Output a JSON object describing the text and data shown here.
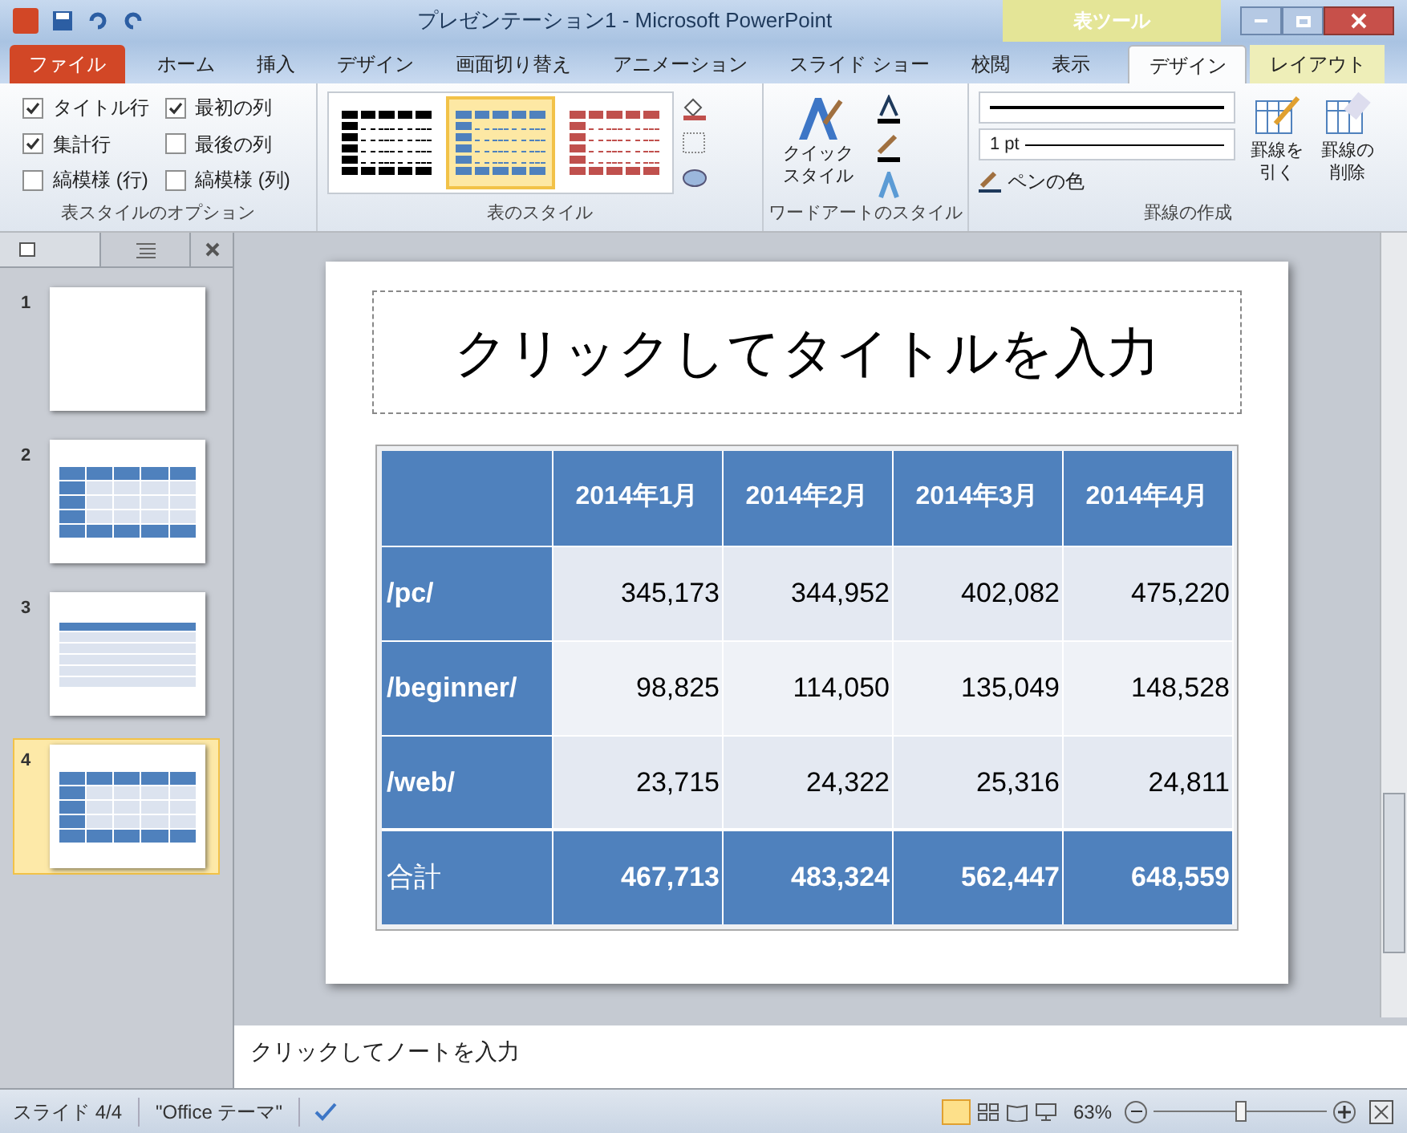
{
  "window": {
    "title": "プレゼンテーション1 - Microsoft PowerPoint",
    "context_group": "表ツール"
  },
  "ribbon_tabs": [
    {
      "label": "ファイル",
      "kind": "file",
      "selected": false
    },
    {
      "label": "ホーム",
      "kind": "tab",
      "selected": false
    },
    {
      "label": "挿入",
      "kind": "tab",
      "selected": false
    },
    {
      "label": "デザイン",
      "kind": "tab",
      "selected": false
    },
    {
      "label": "画面切り替え",
      "kind": "tab",
      "selected": false
    },
    {
      "label": "アニメーション",
      "kind": "tab",
      "selected": false
    },
    {
      "label": "スライド ショー",
      "kind": "tab",
      "selected": false
    },
    {
      "label": "校閲",
      "kind": "tab",
      "selected": false
    },
    {
      "label": "表示",
      "kind": "tab",
      "selected": false
    },
    {
      "label": "デザイン",
      "kind": "context",
      "selected": true
    },
    {
      "label": "レイアウト",
      "kind": "context",
      "selected": false
    }
  ],
  "style_options": {
    "label": "表スタイルのオプション",
    "items": [
      {
        "label": "タイトル行",
        "checked": true
      },
      {
        "label": "集計行",
        "checked": true
      },
      {
        "label": "縞模様 (行)",
        "checked": false
      },
      {
        "label": "最初の列",
        "checked": true
      },
      {
        "label": "最後の列",
        "checked": false
      },
      {
        "label": "縞模様 (列)",
        "checked": false
      }
    ]
  },
  "table_styles": {
    "label": "表のスタイル",
    "styles": [
      {
        "color": "#000000",
        "selected": false
      },
      {
        "color": "#4f81bd",
        "selected": true
      },
      {
        "color": "#c0504d",
        "selected": false
      }
    ]
  },
  "wordart": {
    "label": "ワードアートのスタイル",
    "quick_style": "クイックスタイル"
  },
  "borders": {
    "label": "罫線の作成",
    "pen_weight": "1 pt",
    "pen_color": "ペンの色",
    "draw": "罫線を引く",
    "erase": "罫線の削除"
  },
  "slides": [
    {
      "number": "1",
      "kind": "blank",
      "selected": false
    },
    {
      "number": "2",
      "kind": "table",
      "selected": false
    },
    {
      "number": "3",
      "kind": "list",
      "selected": false
    },
    {
      "number": "4",
      "kind": "table",
      "selected": true
    }
  ],
  "slide": {
    "title": "クリックしてタイトルを入力",
    "table": {
      "columns": [
        "2014年1月",
        "2014年2月",
        "2014年3月",
        "2014年4月"
      ],
      "rows": [
        {
          "kind": "body",
          "label": "/pc/",
          "cells": [
            "345,173",
            "344,952",
            "402,082",
            "475,220"
          ]
        },
        {
          "kind": "body",
          "label": "/beginner/",
          "cells": [
            "98,825",
            "114,050",
            "135,049",
            "148,528"
          ]
        },
        {
          "kind": "body",
          "label": "/web/",
          "cells": [
            "23,715",
            "24,322",
            "25,316",
            "24,811"
          ]
        },
        {
          "kind": "total",
          "label": "合計",
          "cells": [
            "467,713",
            "483,324",
            "562,447",
            "648,559"
          ]
        }
      ]
    }
  },
  "notes": {
    "placeholder": "クリックしてノートを入力"
  },
  "status_bar": {
    "slide": "スライド 4/4",
    "theme": "\"Office テーマ\"",
    "zoom": "63%",
    "zoom_level": {
      "level": 0.5
    }
  }
}
